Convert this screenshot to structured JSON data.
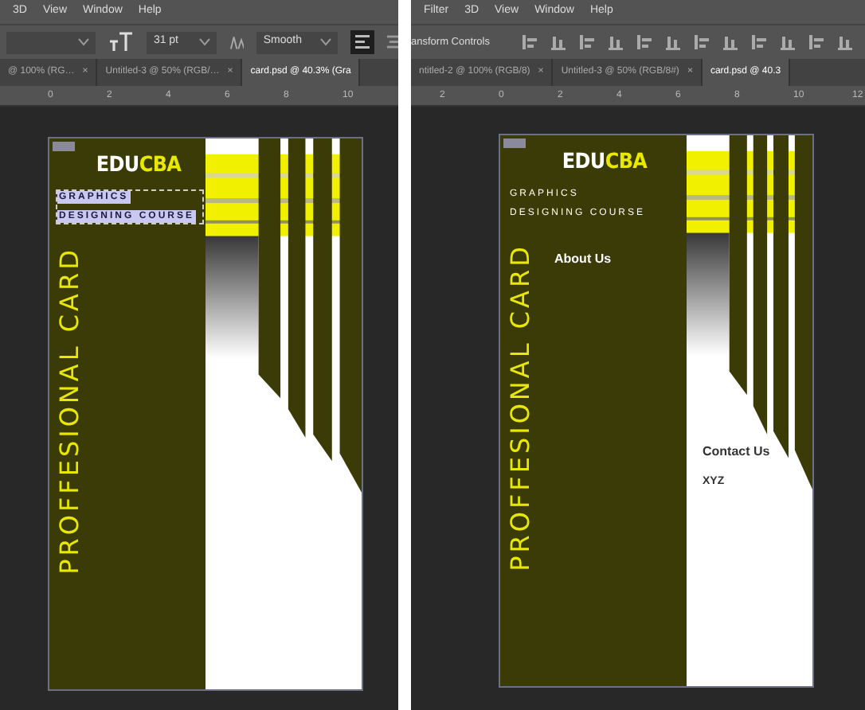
{
  "panels": [
    {
      "menu": [
        "3D",
        "View",
        "Window",
        "Help"
      ],
      "kind": "type",
      "options": {
        "size": "31 pt",
        "antialias": "Smooth"
      },
      "tabs": [
        {
          "label": "@ 100% (RG…",
          "close": "×",
          "selected": false
        },
        {
          "label": "Untitled-3 @ 50% (RGB/…",
          "close": "×",
          "selected": false
        },
        {
          "label": "card.psd @ 40.3% (Gra",
          "selected": true
        }
      ],
      "ruler": [
        "0",
        "2",
        "4",
        "6",
        "8",
        "10"
      ],
      "card": {
        "logo_a": "EDU",
        "logo_b": "CBA",
        "subtitle": [
          "GRAPHICS",
          "DESIGNING COURSE"
        ],
        "text_selected": true,
        "vertical_title": "PROFFESIONAL CARD"
      }
    },
    {
      "menu": [
        "Filter",
        "3D",
        "View",
        "Window",
        "Help"
      ],
      "kind": "move",
      "options": {
        "label": "ansform Controls"
      },
      "tabs": [
        {
          "label": "ntitled-2 @ 100% (RGB/8)",
          "close": "×",
          "selected": false
        },
        {
          "label": "Untitled-3 @ 50% (RGB/8#)",
          "close": "×",
          "selected": false
        },
        {
          "label": "card.psd @ 40.3",
          "selected": true
        }
      ],
      "ruler": [
        "2",
        "0",
        "2",
        "4",
        "6",
        "8",
        "10",
        "12"
      ],
      "card": {
        "logo_a": "EDU",
        "logo_b": "CBA",
        "subtitle": [
          "GRAPHICS",
          "DESIGNING COURSE"
        ],
        "text_selected": false,
        "vertical_title": "PROFFESIONAL CARD",
        "about": "About Us",
        "contact": "Contact Us",
        "name": "XYZ"
      }
    }
  ]
}
